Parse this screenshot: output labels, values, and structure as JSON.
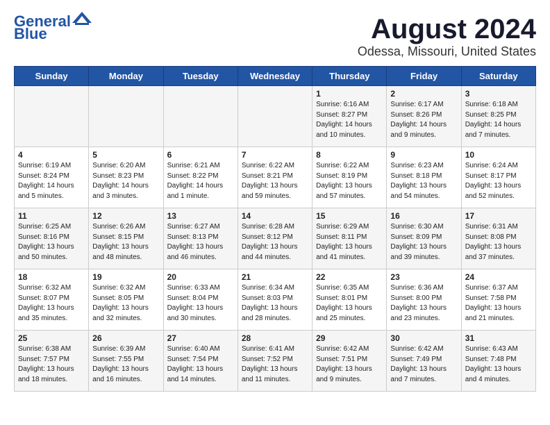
{
  "logo": {
    "line1": "General",
    "line2": "Blue"
  },
  "title": "August 2024",
  "subtitle": "Odessa, Missouri, United States",
  "days_of_week": [
    "Sunday",
    "Monday",
    "Tuesday",
    "Wednesday",
    "Thursday",
    "Friday",
    "Saturday"
  ],
  "weeks": [
    [
      {
        "day": "",
        "info": ""
      },
      {
        "day": "",
        "info": ""
      },
      {
        "day": "",
        "info": ""
      },
      {
        "day": "",
        "info": ""
      },
      {
        "day": "1",
        "info": "Sunrise: 6:16 AM\nSunset: 8:27 PM\nDaylight: 14 hours\nand 10 minutes."
      },
      {
        "day": "2",
        "info": "Sunrise: 6:17 AM\nSunset: 8:26 PM\nDaylight: 14 hours\nand 9 minutes."
      },
      {
        "day": "3",
        "info": "Sunrise: 6:18 AM\nSunset: 8:25 PM\nDaylight: 14 hours\nand 7 minutes."
      }
    ],
    [
      {
        "day": "4",
        "info": "Sunrise: 6:19 AM\nSunset: 8:24 PM\nDaylight: 14 hours\nand 5 minutes."
      },
      {
        "day": "5",
        "info": "Sunrise: 6:20 AM\nSunset: 8:23 PM\nDaylight: 14 hours\nand 3 minutes."
      },
      {
        "day": "6",
        "info": "Sunrise: 6:21 AM\nSunset: 8:22 PM\nDaylight: 14 hours\nand 1 minute."
      },
      {
        "day": "7",
        "info": "Sunrise: 6:22 AM\nSunset: 8:21 PM\nDaylight: 13 hours\nand 59 minutes."
      },
      {
        "day": "8",
        "info": "Sunrise: 6:22 AM\nSunset: 8:19 PM\nDaylight: 13 hours\nand 57 minutes."
      },
      {
        "day": "9",
        "info": "Sunrise: 6:23 AM\nSunset: 8:18 PM\nDaylight: 13 hours\nand 54 minutes."
      },
      {
        "day": "10",
        "info": "Sunrise: 6:24 AM\nSunset: 8:17 PM\nDaylight: 13 hours\nand 52 minutes."
      }
    ],
    [
      {
        "day": "11",
        "info": "Sunrise: 6:25 AM\nSunset: 8:16 PM\nDaylight: 13 hours\nand 50 minutes."
      },
      {
        "day": "12",
        "info": "Sunrise: 6:26 AM\nSunset: 8:15 PM\nDaylight: 13 hours\nand 48 minutes."
      },
      {
        "day": "13",
        "info": "Sunrise: 6:27 AM\nSunset: 8:13 PM\nDaylight: 13 hours\nand 46 minutes."
      },
      {
        "day": "14",
        "info": "Sunrise: 6:28 AM\nSunset: 8:12 PM\nDaylight: 13 hours\nand 44 minutes."
      },
      {
        "day": "15",
        "info": "Sunrise: 6:29 AM\nSunset: 8:11 PM\nDaylight: 13 hours\nand 41 minutes."
      },
      {
        "day": "16",
        "info": "Sunrise: 6:30 AM\nSunset: 8:09 PM\nDaylight: 13 hours\nand 39 minutes."
      },
      {
        "day": "17",
        "info": "Sunrise: 6:31 AM\nSunset: 8:08 PM\nDaylight: 13 hours\nand 37 minutes."
      }
    ],
    [
      {
        "day": "18",
        "info": "Sunrise: 6:32 AM\nSunset: 8:07 PM\nDaylight: 13 hours\nand 35 minutes."
      },
      {
        "day": "19",
        "info": "Sunrise: 6:32 AM\nSunset: 8:05 PM\nDaylight: 13 hours\nand 32 minutes."
      },
      {
        "day": "20",
        "info": "Sunrise: 6:33 AM\nSunset: 8:04 PM\nDaylight: 13 hours\nand 30 minutes."
      },
      {
        "day": "21",
        "info": "Sunrise: 6:34 AM\nSunset: 8:03 PM\nDaylight: 13 hours\nand 28 minutes."
      },
      {
        "day": "22",
        "info": "Sunrise: 6:35 AM\nSunset: 8:01 PM\nDaylight: 13 hours\nand 25 minutes."
      },
      {
        "day": "23",
        "info": "Sunrise: 6:36 AM\nSunset: 8:00 PM\nDaylight: 13 hours\nand 23 minutes."
      },
      {
        "day": "24",
        "info": "Sunrise: 6:37 AM\nSunset: 7:58 PM\nDaylight: 13 hours\nand 21 minutes."
      }
    ],
    [
      {
        "day": "25",
        "info": "Sunrise: 6:38 AM\nSunset: 7:57 PM\nDaylight: 13 hours\nand 18 minutes."
      },
      {
        "day": "26",
        "info": "Sunrise: 6:39 AM\nSunset: 7:55 PM\nDaylight: 13 hours\nand 16 minutes."
      },
      {
        "day": "27",
        "info": "Sunrise: 6:40 AM\nSunset: 7:54 PM\nDaylight: 13 hours\nand 14 minutes."
      },
      {
        "day": "28",
        "info": "Sunrise: 6:41 AM\nSunset: 7:52 PM\nDaylight: 13 hours\nand 11 minutes."
      },
      {
        "day": "29",
        "info": "Sunrise: 6:42 AM\nSunset: 7:51 PM\nDaylight: 13 hours\nand 9 minutes."
      },
      {
        "day": "30",
        "info": "Sunrise: 6:42 AM\nSunset: 7:49 PM\nDaylight: 13 hours\nand 7 minutes."
      },
      {
        "day": "31",
        "info": "Sunrise: 6:43 AM\nSunset: 7:48 PM\nDaylight: 13 hours\nand 4 minutes."
      }
    ]
  ]
}
